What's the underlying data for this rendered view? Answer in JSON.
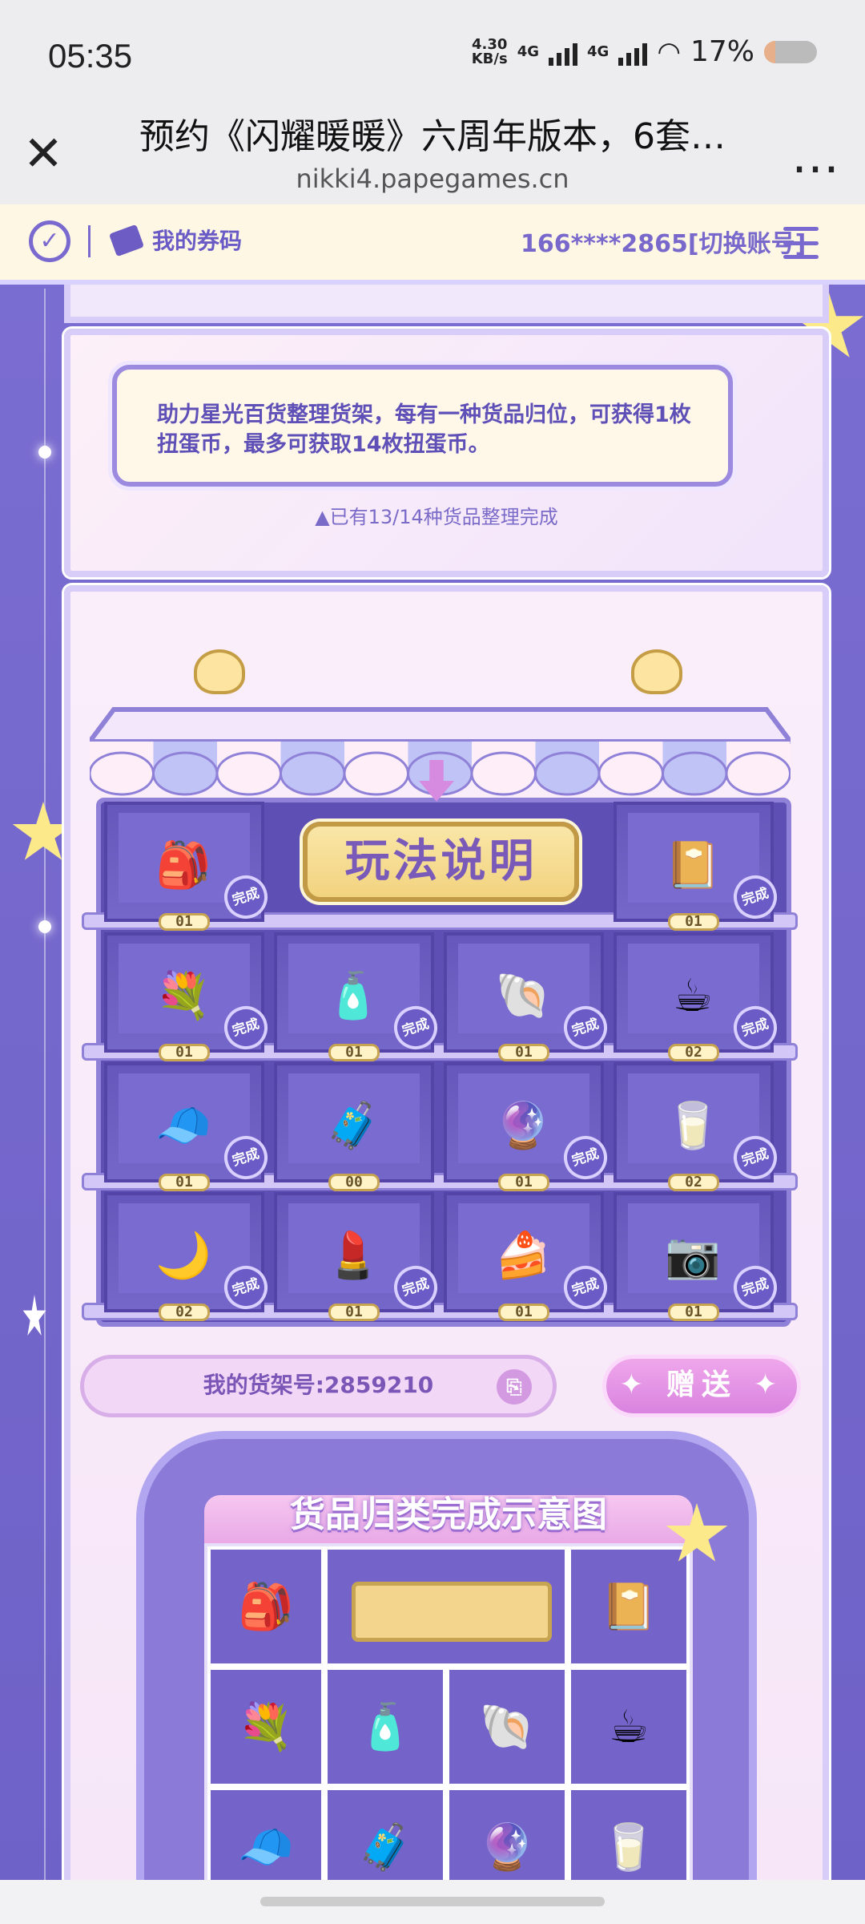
{
  "status_bar": {
    "time": "05:35",
    "net_speed_value": "4.30",
    "net_speed_unit": "KB/s",
    "network_1": "4G",
    "network_2": "4G",
    "battery": "17%"
  },
  "browser": {
    "title": "预约《闪耀暖暖》六周年版本，6套…",
    "url": "nikki4.papegames.cn",
    "close_icon": "close-icon",
    "more_icon": "more-icon"
  },
  "app_bar": {
    "coupon_label": "我的券码",
    "account": "166****2865[切换账号]"
  },
  "intro": {
    "description": "助力星光百货整理货架，每有一种货品归位，可获得1枚扭蛋币，最多可获取14枚扭蛋币。",
    "progress": "▲已有13/14种货品整理完成",
    "progress_fraction": 0.93
  },
  "shop": {
    "rules_button": "玩法说明",
    "done_label": "完成",
    "cells": [
      {
        "icon": "🎒",
        "name": "backpack",
        "count": "01",
        "done": true
      },
      {
        "icon": "📔",
        "name": "photo-album",
        "count": "01",
        "done": true
      },
      {
        "icon": "💐",
        "name": "flower-basket",
        "count": "01",
        "done": true
      },
      {
        "icon": "🧴",
        "name": "perfume-bottle",
        "count": "01",
        "done": true
      },
      {
        "icon": "🐚",
        "name": "shell-box",
        "count": "01",
        "done": true
      },
      {
        "icon": "☕",
        "name": "bunny-mug",
        "count": "02",
        "done": true
      },
      {
        "icon": "🧢",
        "name": "bunny-cap",
        "count": "01",
        "done": true
      },
      {
        "icon": "🧳",
        "name": "suitcase",
        "count": "00",
        "done": false
      },
      {
        "icon": "🔮",
        "name": "crystal-ball",
        "count": "01",
        "done": true
      },
      {
        "icon": "🥛",
        "name": "milk-carton",
        "count": "02",
        "done": true
      },
      {
        "icon": "🌙",
        "name": "moon-pillow",
        "count": "02",
        "done": true
      },
      {
        "icon": "💄",
        "name": "nikki-palette",
        "count": "01",
        "done": true
      },
      {
        "icon": "🍰",
        "name": "cake",
        "count": "01",
        "done": true
      },
      {
        "icon": "📷",
        "name": "camera",
        "count": "01",
        "done": true
      }
    ]
  },
  "shelf_id": "我的货架号:2859210",
  "gift_button": "赠送",
  "demo": {
    "title": "货品归类完成示意图",
    "items": [
      "🎒",
      "📔",
      "💐",
      "🧴",
      "🐚",
      "☕",
      "🧢",
      "🧳",
      "🔮",
      "🥛"
    ]
  },
  "colors": {
    "accent": "#7a6ad0",
    "background": "#7b6fd0",
    "plaque": "#f3d58e"
  }
}
